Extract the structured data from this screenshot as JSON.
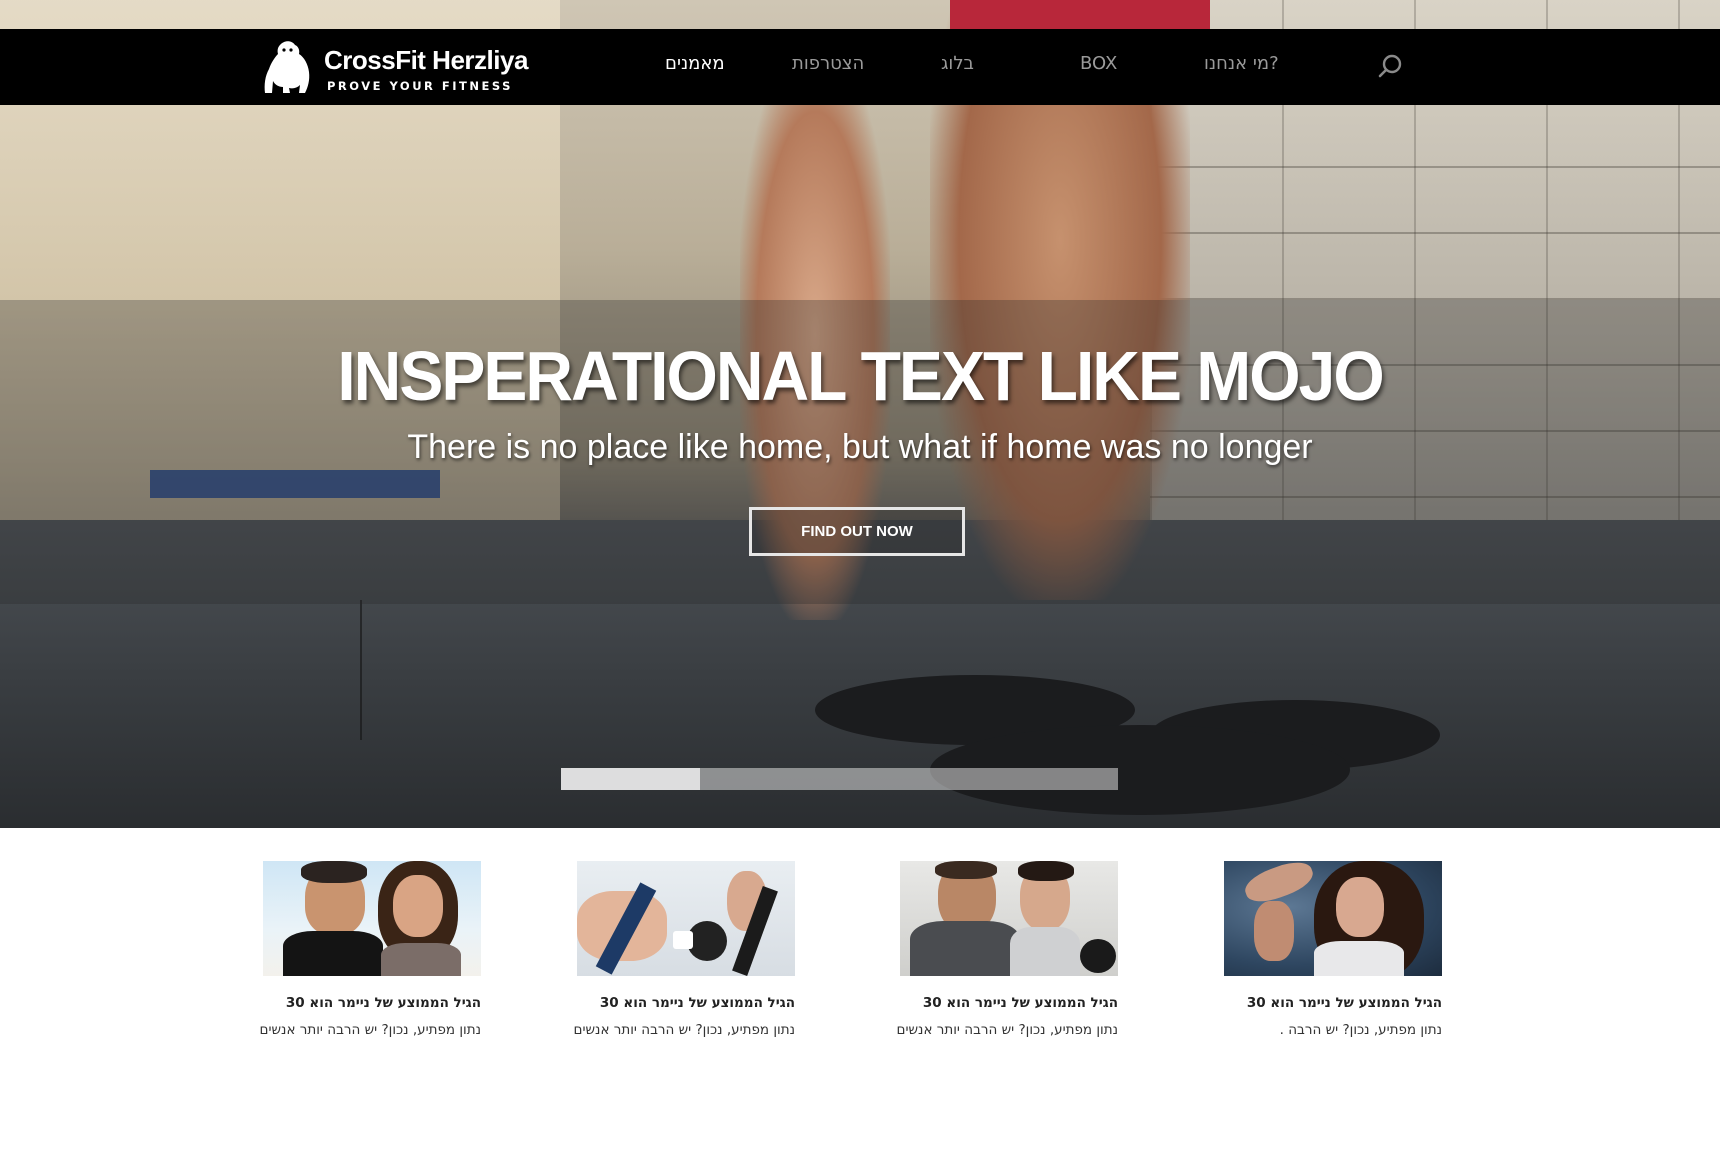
{
  "brand": {
    "name": "CrossFit Herzliya",
    "tagline": "PROVE YOUR FITNESS"
  },
  "nav": {
    "items": [
      {
        "label": "מאמנים",
        "active": true
      },
      {
        "label": "הצטרפות",
        "active": false
      },
      {
        "label": "בלוג",
        "active": false
      },
      {
        "label": "BOX",
        "active": false
      },
      {
        "label": "מי אנחנו?",
        "active": false
      }
    ],
    "search_icon": "search-icon"
  },
  "hero": {
    "title": "INSPERATIONAL TEXT LIKE MOJO",
    "subtitle": "There is no place like home, but what if home was no longer",
    "cta_label": "FIND OUT NOW",
    "progress": 0.25
  },
  "cards": [
    {
      "title": "הגיל הממוצע של ניימר הוא 30",
      "text": "נתון מפתיע, נכון? יש הרבה יותר אנשים",
      "image": "couple-smiling"
    },
    {
      "title": "הגיל הממוצע של ניימר הוא 30",
      "text": "נתון מפתיע, נכון? יש הרבה יותר אנשים",
      "image": "stationary-bikes"
    },
    {
      "title": "הגיל הממוצע של ניימר הוא 30",
      "text": "נתון מפתיע, נכון? יש הרבה יותר אנשים",
      "image": "couple-dumbbells"
    },
    {
      "title": "הגיל הממוצע של ניימר הוא 30",
      "text": "נתון מפתיע, נכון? יש הרבה .",
      "image": "woman-flexing"
    }
  ],
  "colors": {
    "navbar": "#000000",
    "nav_active": "#ffffff",
    "nav_inactive": "#9a9a9a"
  }
}
